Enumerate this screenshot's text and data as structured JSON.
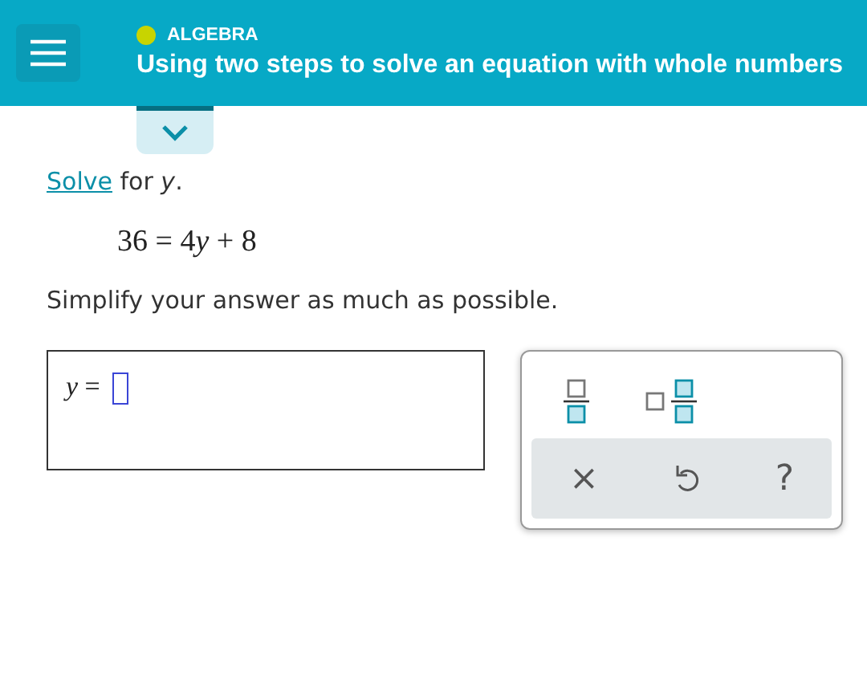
{
  "header": {
    "topic": {
      "label": "ALGEBRA",
      "color": "#c8d400"
    },
    "title": "Using two steps to solve an equation with whole numbers"
  },
  "question": {
    "link": "Solve",
    "prompt": "for *y*.",
    "equation": [
      {
        "kind": "text",
        "text": "36 = 4"
      },
      {
        "kind": "variable",
        "text": "y"
      },
      {
        "kind": "text",
        "text": " + 8"
      }
    ],
    "instruction": "Simplify your answer as much as possible."
  },
  "answer": {
    "label": "*y* ="
  },
  "keypad": {
    "keys": [
      {
        "kind": "fraction"
      },
      {
        "kind": "mixed"
      }
    ],
    "actions": [
      {
        "kind": "text",
        "label": "×"
      },
      {
        "kind": "undo"
      },
      {
        "kind": "text",
        "label": "?"
      }
    ]
  }
}
